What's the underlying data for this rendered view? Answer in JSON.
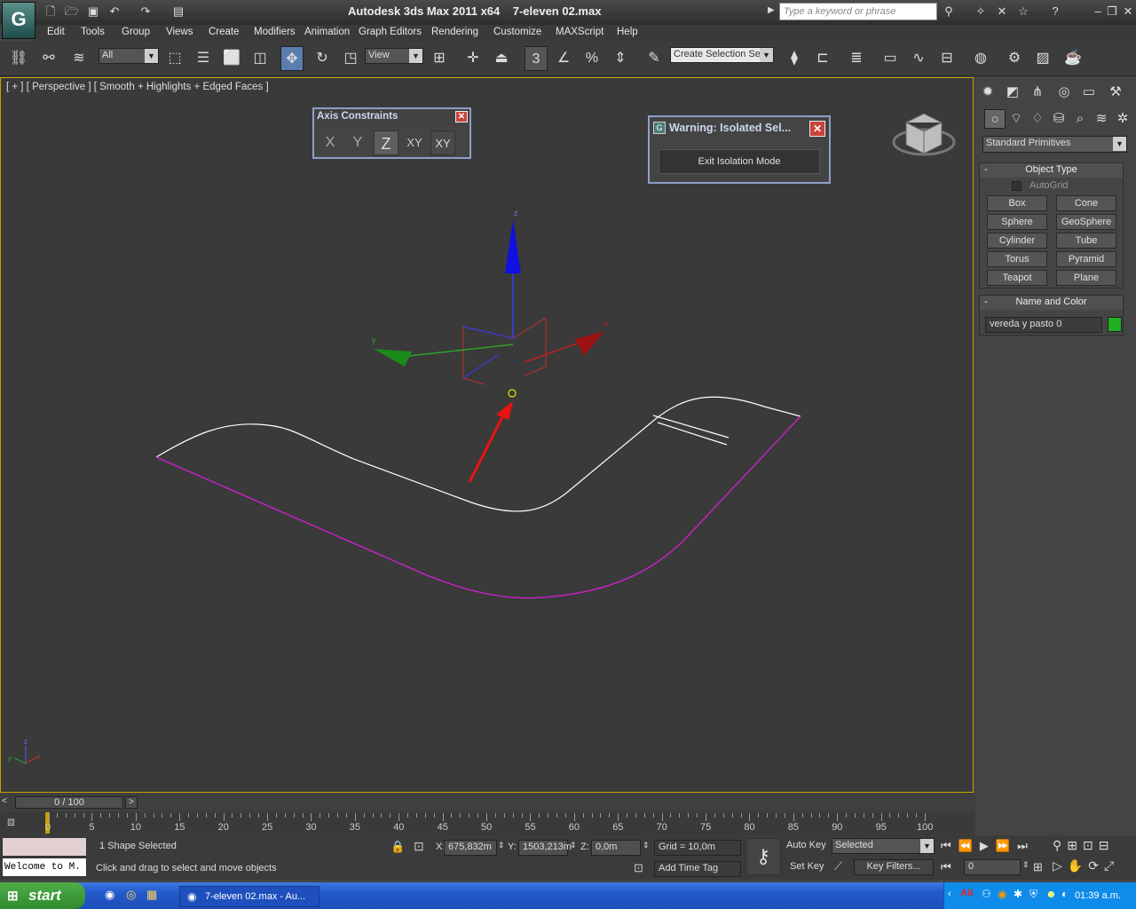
{
  "titlebar": {
    "app_title": "Autodesk 3ds Max  2011 x64",
    "file_name": "7-eleven 02.max",
    "search_placeholder": "Type a keyword or phrase"
  },
  "menu": [
    "Edit",
    "Tools",
    "Group",
    "Views",
    "Create",
    "Modifiers",
    "Animation",
    "Graph Editors",
    "Rendering",
    "Customize",
    "MAXScript",
    "Help"
  ],
  "toolbar": {
    "selection_filter": "All",
    "ref_coord": "View",
    "named_selection": "Create Selection Se"
  },
  "viewport": {
    "label": "[ + ] [ Perspective ] [ Smooth + Highlights + Edged Faces ]",
    "gizmo_axis_x": "x",
    "gizmo_axis_y": "y",
    "gizmo_axis_z": "z"
  },
  "axis_constraints": {
    "title": "Axis Constraints",
    "buttons": [
      "X",
      "Y",
      "Z",
      "XY",
      "XY"
    ],
    "active": "Z"
  },
  "warning_dialog": {
    "title": "Warning: Isolated Sel...",
    "button": "Exit Isolation Mode"
  },
  "command_panel": {
    "category": "Standard Primitives",
    "object_type_title": "Object Type",
    "autogrid_label": "AutoGrid",
    "primitives": [
      "Box",
      "Cone",
      "Sphere",
      "GeoSphere",
      "Cylinder",
      "Tube",
      "Torus",
      "Pyramid",
      "Teapot",
      "Plane"
    ],
    "name_color_title": "Name and Color",
    "object_name": "vereda y pasto 0",
    "object_color": "#22b022"
  },
  "timeline": {
    "frame_slider": "0 / 100",
    "ticks": [
      "0",
      "5",
      "10",
      "15",
      "20",
      "25",
      "30",
      "35",
      "40",
      "45",
      "50",
      "55",
      "60",
      "65",
      "70",
      "75",
      "80",
      "85",
      "90",
      "95",
      "100"
    ]
  },
  "status": {
    "welcome": "Welcome to M.",
    "selection_info": "1 Shape Selected",
    "prompt": "Click and drag to select and move objects",
    "x_label": "X:",
    "x_value": "675,832m",
    "y_label": "Y:",
    "y_value": "1503,213m",
    "z_label": "Z:",
    "z_value": "0,0m",
    "grid": "Grid = 10,0m",
    "add_time_tag": "Add Time Tag",
    "auto_key": "Auto Key",
    "set_key": "Set Key",
    "key_mode": "Selected",
    "key_filters": "Key Filters...",
    "current_frame": "0"
  },
  "taskbar": {
    "start_label": "start",
    "task_item": "7-eleven 02.max - Au...",
    "clock": "01:39 a.m."
  },
  "colors": {
    "viewport_border": "#c8a000",
    "spline_selected": "#d21fd2",
    "spline_default": "#ffffff"
  }
}
